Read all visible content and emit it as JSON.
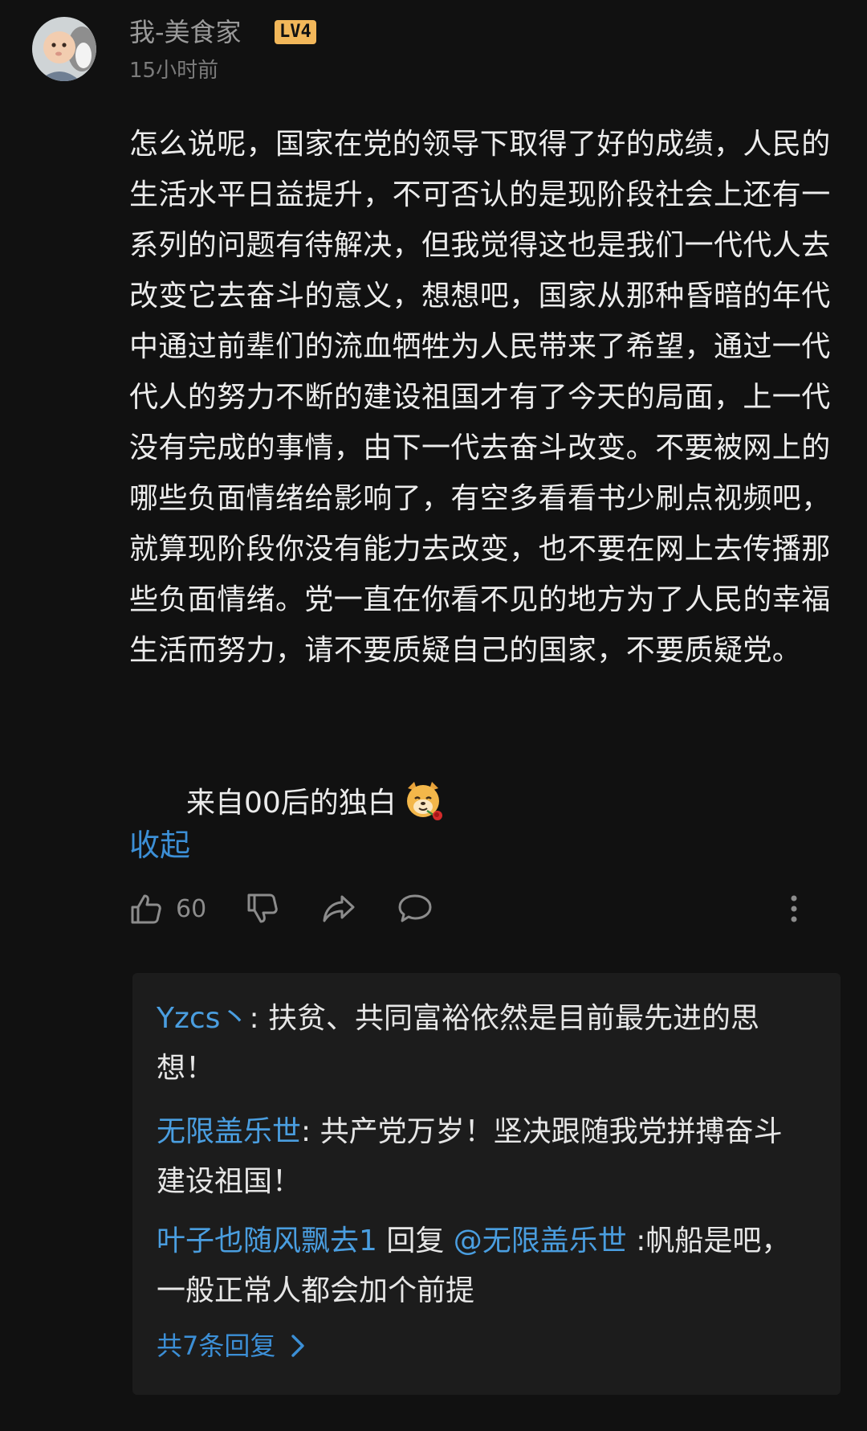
{
  "comment": {
    "author": "我-美食家",
    "level": "LV4",
    "time": "15小时前",
    "body": "怎么说呢，国家在党的领导下取得了好的成绩，人民的生活水平日益提升，不可否认的是现阶段社会上还有一系列的问题有待解决，但我觉得这也是我们一代代人去改变它去奋斗的意义，想想吧，国家从那种昏暗的年代中通过前辈们的流血牺牲为人民带来了希望，通过一代代人的努力不断的建设祖国才有了今天的局面，上一代没有完成的事情，由下一代去奋斗改变。不要被网上的哪些负面情绪给影响了，有空多看看书少刷点视频吧，就算现阶段你没有能力去改变，也不要在网上去传播那些负面情绪。党一直在你看不见的地方为了人民的幸福生活而努力，请不要质疑自己的国家，不要质疑党。",
    "signature": "来自00后的独白",
    "collapse_label": "收起",
    "like_count": "60"
  },
  "replies": [
    {
      "author": "Yzcs丶",
      "separator": ":",
      "text": " 扶贫、共同富裕依然是目前最先进的思想！"
    },
    {
      "author": "无限盖乐世",
      "separator": ":",
      "text": " 共产党万岁！坚决跟随我党拼搏奋斗建设祖国！"
    },
    {
      "author": "叶子也随风飘去1",
      "reply_word": " 回复 ",
      "mention": "@无限盖乐世",
      "separator": " :",
      "text": "帆船是吧，一般正常人都会加个前提"
    }
  ],
  "more_replies_label": "共7条回复",
  "icons": {
    "like": "thumbs-up-icon",
    "dislike": "thumbs-down-icon",
    "share": "share-arrow-icon",
    "comment": "speech-bubble-icon",
    "more": "vertical-dots-icon",
    "emoji": "dog-with-rose-emoji-icon"
  },
  "colors": {
    "background": "#111111",
    "link_blue": "#3c8fd6",
    "badge_orange": "#f2b75a",
    "reply_box": "#1c1c1c"
  }
}
